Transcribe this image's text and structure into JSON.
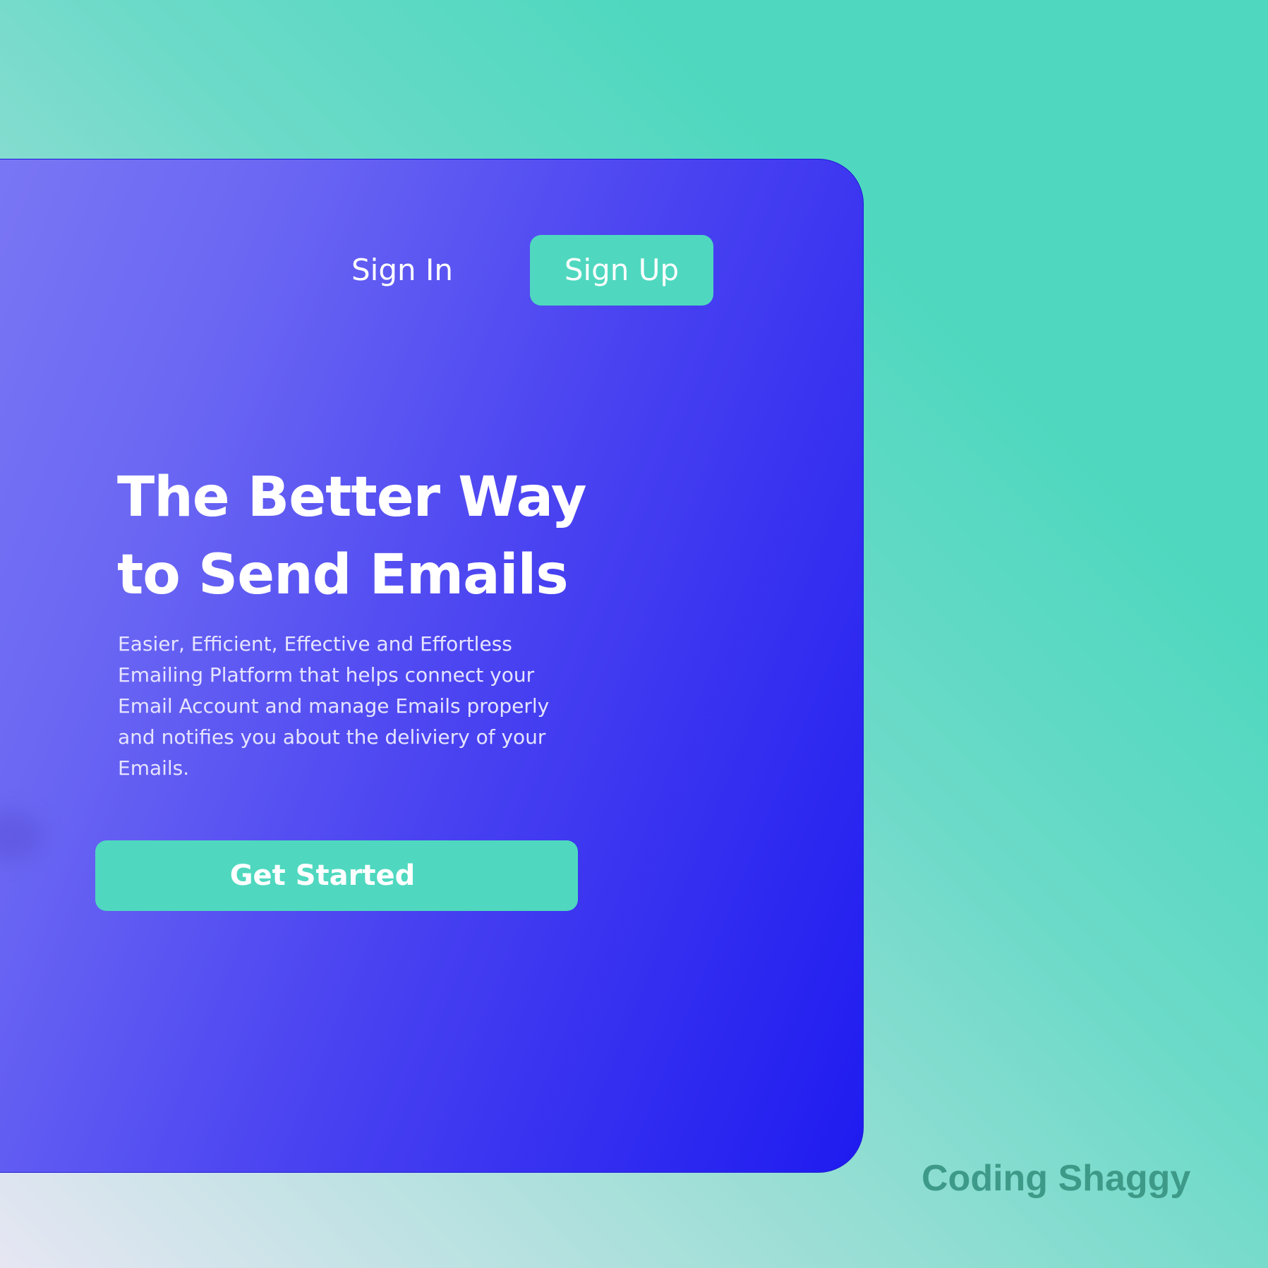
{
  "nav": {
    "sign_in_label": "Sign In",
    "sign_up_label": "Sign Up"
  },
  "hero": {
    "headline_line1": "The Better Way",
    "headline_line2": "to Send Emails",
    "description": "Easier, Efficient, Effective and Effortless Emailing Platform that helps connect your Email Account and manage Emails properly and notifies you about the deliviery of your Emails.",
    "cta_label": "Get Started"
  },
  "watermark": "Coding Shaggy",
  "colors": {
    "accent": "#4fd8bf",
    "card_gradient_start": "#7b78f5",
    "card_gradient_end": "#1f1bf0",
    "watermark_text": "#3e9a88"
  }
}
